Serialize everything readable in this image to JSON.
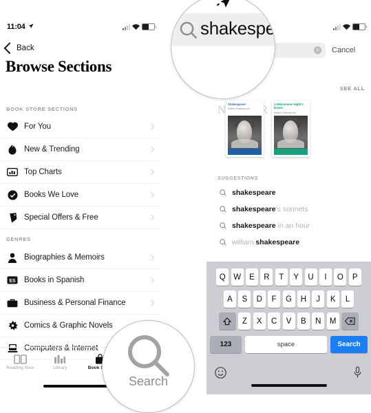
{
  "meta": {
    "app": "Apple Books",
    "accent_blue": "#1b7ef5",
    "keyboard_bg": "#cdced3",
    "cover_band_left": "#1f5fa8",
    "cover_band_right": "#17a07d"
  },
  "status_bar": {
    "time": "11:04",
    "location_arrow": "location-arrow-icon",
    "signal": "cellular-signal-icon",
    "wifi": "wifi-icon",
    "battery": "battery-icon"
  },
  "left_phone": {
    "back_label": "Back",
    "page_title": "Browse Sections",
    "section_headers": {
      "bookstore": "BOOK STORE SECTIONS",
      "genres": "GENRES"
    },
    "bookstore_items": [
      {
        "label": "For You",
        "icon": "heart-icon"
      },
      {
        "label": "New & Trending",
        "icon": "flame-icon"
      },
      {
        "label": "Top Charts",
        "icon": "chart-card-icon"
      },
      {
        "label": "Books We Love",
        "icon": "check-badge-icon"
      },
      {
        "label": "Special Offers & Free",
        "icon": "price-tag-icon"
      }
    ],
    "genre_items": [
      {
        "label": "Biographies & Memoirs",
        "icon": "person-icon"
      },
      {
        "label": "Books in Spanish",
        "icon": "es-badge-icon"
      },
      {
        "label": "Business & Personal Finance",
        "icon": "briefcase-icon"
      },
      {
        "label": "Comics & Graphic Novels",
        "icon": "comics-icon"
      },
      {
        "label": "Computers & Internet",
        "icon": "laptop-icon"
      }
    ],
    "tabs": [
      {
        "label": "Reading Now",
        "icon": "open-book-icon",
        "active": false
      },
      {
        "label": "Library",
        "icon": "library-shelf-icon",
        "active": false
      },
      {
        "label": "Book Store",
        "icon": "shopping-bag-icon",
        "active": true
      },
      {
        "label": "Search",
        "icon": "search-icon",
        "active": false
      }
    ]
  },
  "right_phone": {
    "search": {
      "value": "shakespea",
      "placeholder": "Search",
      "magnifier_icon": "search-icon",
      "clear_icon": "clear-circle-icon",
      "cancel_label": "Cancel"
    },
    "results_strip": {
      "see_all_label": "SEE ALL",
      "strip_title": "ND LIBR",
      "covers": [
        {
          "title": "Shakespeare",
          "author": "William Shakespeare",
          "band_color": "#1f5fa8"
        },
        {
          "title": "A Midsummer Night's Dream",
          "author": "William Shakespeare",
          "band_color": "#17a07d"
        }
      ]
    },
    "suggestions_header": "SUGGESTIONS",
    "suggestions": [
      {
        "match": "shakespeare",
        "rest": ""
      },
      {
        "match": "shakespeare",
        "rest": "'s sonnets"
      },
      {
        "match": "shakespeare",
        "rest": " in an hour"
      },
      {
        "match": "shakespeare",
        "rest": "",
        "prefix": "william "
      }
    ],
    "keyboard": {
      "row1": [
        "Q",
        "W",
        "E",
        "R",
        "T",
        "Y",
        "U",
        "I",
        "O",
        "P"
      ],
      "row2": [
        "A",
        "S",
        "D",
        "F",
        "G",
        "H",
        "J",
        "K",
        "L"
      ],
      "row3": [
        "Z",
        "X",
        "C",
        "V",
        "B",
        "N",
        "M"
      ],
      "shift_icon": "shift-icon",
      "backspace_icon": "backspace-icon",
      "numbers_label": "123",
      "space_label": "space",
      "search_label": "Search",
      "emoji_icon": "emoji-icon",
      "mic_icon": "microphone-icon"
    }
  },
  "callouts": {
    "top": {
      "text": "shakespea",
      "icon": "search-icon"
    },
    "bottom": {
      "label": "Search",
      "icon": "search-icon"
    },
    "cursor": "mouse-cursor-icon"
  }
}
